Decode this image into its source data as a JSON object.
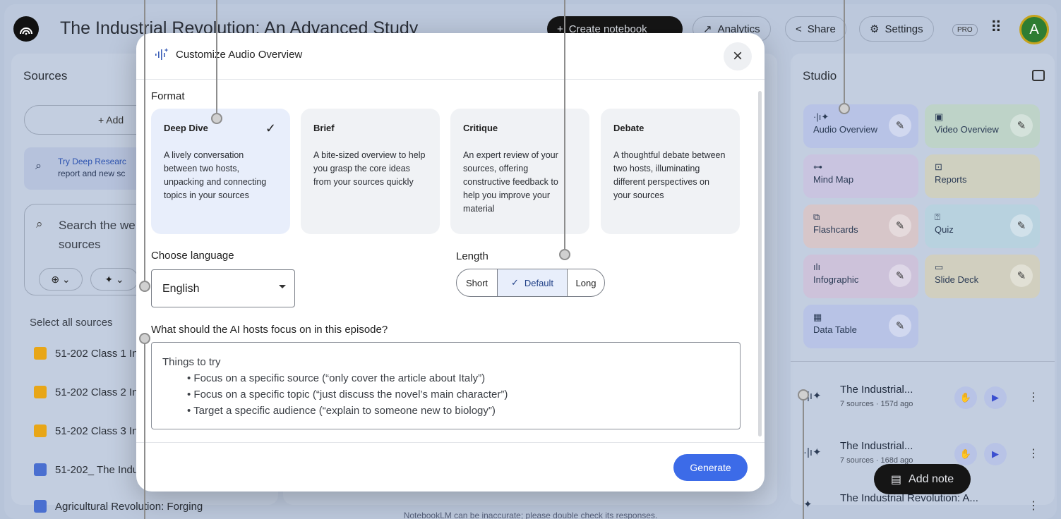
{
  "app": {
    "title": "The Industrial Revolution: An Advanced Study",
    "create_label": "Create notebook",
    "analytics_label": "Analytics",
    "share_label": "Share",
    "settings_label": "Settings",
    "pro_label": "PRO",
    "avatar_initial": "A"
  },
  "sources": {
    "title": "Sources",
    "add_label": "+ Add",
    "banner_line1": "Try Deep Researc",
    "banner_line2": "report and new sc",
    "search_line1": "Search the we",
    "search_line2": "sources",
    "select_all": "Select all sources",
    "items": [
      {
        "label": "51-202 Class 1 In",
        "icon_color": "#e8a617"
      },
      {
        "label": "51-202 Class 2 In",
        "icon_color": "#e8a617"
      },
      {
        "label": "51-202 Class 3 In",
        "icon_color": "#e8a617"
      },
      {
        "label": "51-202_ The Indu",
        "icon_color": "#4a6fd0"
      },
      {
        "label": "Agricultural Revolution: Forging",
        "icon_color": "#4a6fd0"
      }
    ]
  },
  "studio": {
    "title": "Studio",
    "tiles": [
      {
        "label": "Audio Overview",
        "icon": "waveform-icon",
        "bg": "#b8c3e6"
      },
      {
        "label": "Video Overview",
        "icon": "video-icon",
        "bg": "#bed3c8"
      },
      {
        "label": "Mind Map",
        "icon": "mindmap-icon",
        "bg": "#c9c4e0"
      },
      {
        "label": "Reports",
        "icon": "report-icon",
        "bg": "#cfd0c0"
      },
      {
        "label": "Flashcards",
        "icon": "flashcards-icon",
        "bg": "#d7c6c9"
      },
      {
        "label": "Quiz",
        "icon": "quiz-icon",
        "bg": "#b8d2df"
      },
      {
        "label": "Infographic",
        "icon": "infographic-icon",
        "bg": "#cdc2da"
      },
      {
        "label": "Slide Deck",
        "icon": "slides-icon",
        "bg": "#d1cfbf"
      },
      {
        "label": "Data Table",
        "icon": "table-icon",
        "bg": "#b8c3e6"
      }
    ],
    "recent": [
      {
        "title": "The Industrial...",
        "sub": "7 sources · 157d ago"
      },
      {
        "title": "The Industrial...",
        "sub": "7 sources · 168d ago"
      },
      {
        "title": "The Industrial Revolution: A...",
        "sub": ""
      }
    ],
    "add_note_label": "Add note"
  },
  "footer_note": "NotebookLM can be inaccurate; please double check its responses.",
  "modal": {
    "title": "Customize Audio Overview",
    "format_label": "Format",
    "formats": [
      {
        "title": "Deep Dive",
        "desc": "A lively conversation between two hosts, unpacking and connecting topics in your sources",
        "selected": true
      },
      {
        "title": "Brief",
        "desc": "A bite-sized overview to help you grasp the core ideas from your sources quickly",
        "selected": false
      },
      {
        "title": "Critique",
        "desc": "An expert review of your sources, offering constructive feedback to help you improve your material",
        "selected": false
      },
      {
        "title": "Debate",
        "desc": "A thoughtful debate between two hosts, illuminating different perspectives on your sources",
        "selected": false
      }
    ],
    "language_label": "Choose language",
    "language_value": "English",
    "length_label": "Length",
    "length_options": [
      "Short",
      "Default",
      "Long"
    ],
    "length_selected": "Default",
    "focus_label": "What should the AI hosts focus on in this episode?",
    "focus_placeholder_title": "Things to try",
    "focus_items": [
      "• Focus on a specific source (“only cover the article about Italy”)",
      "• Focus on a specific topic (“just discuss the novel’s main character”)",
      "• Target a specific audience (“explain to someone new to biology”)"
    ],
    "generate_label": "Generate"
  }
}
